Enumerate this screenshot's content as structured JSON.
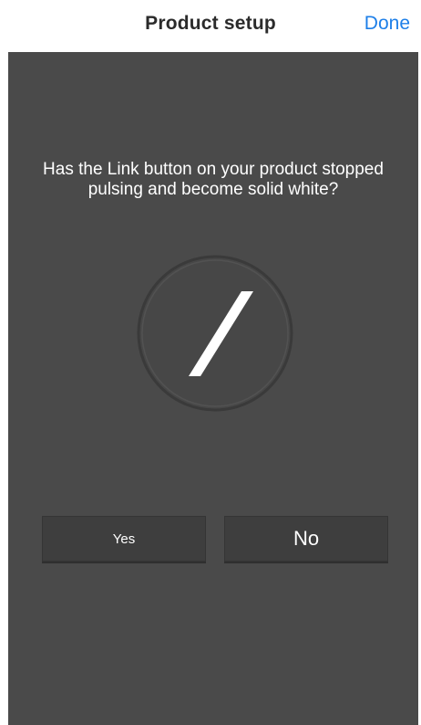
{
  "header": {
    "title": "Product setup",
    "done_label": "Done"
  },
  "colors": {
    "accent": "#1e7fe8",
    "panel_background": "#4a4a4a",
    "led": "#ffffff"
  },
  "prompt": {
    "question": "Has the Link button on your product stopped pulsing and become solid white?",
    "indicator_icon": "link-button-led-icon",
    "led_state": "solid white"
  },
  "answers": {
    "yes_label": "Yes",
    "no_label": "No"
  }
}
